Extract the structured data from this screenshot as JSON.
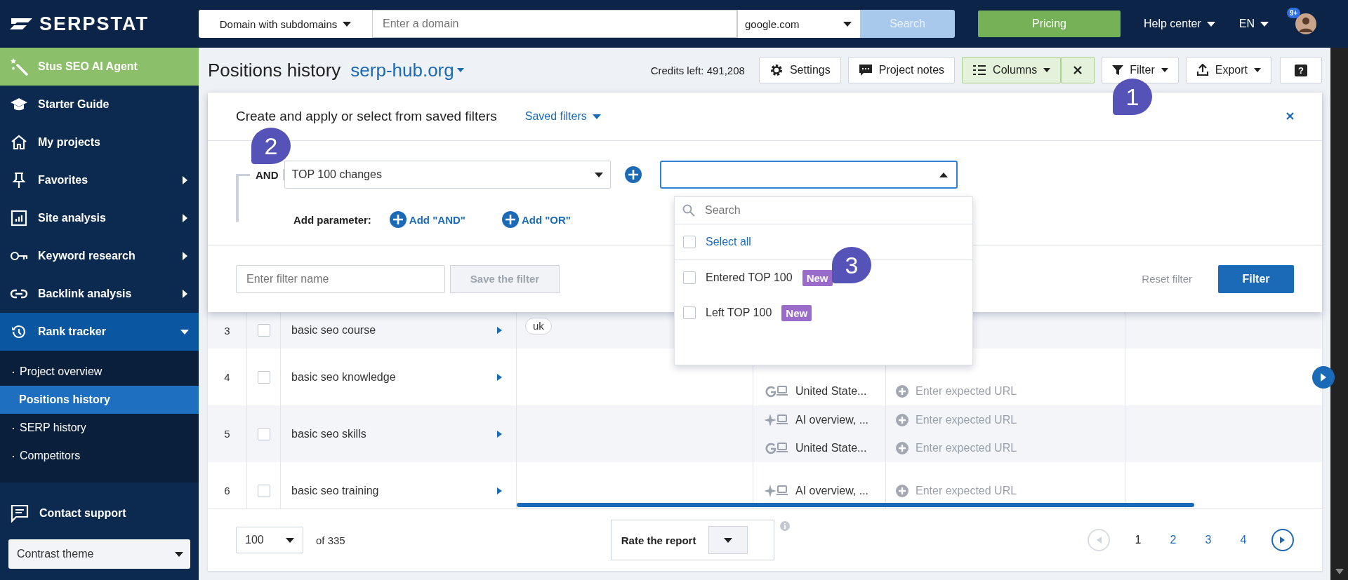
{
  "topbar": {
    "logo": "SERPSTAT",
    "search_type": "Domain with subdomains",
    "domain_placeholder": "Enter a domain",
    "engine": "google.com",
    "search_button": "Search",
    "pricing": "Pricing",
    "help": "Help center",
    "language": "EN",
    "notifications": "9+"
  },
  "sidebar": {
    "agent": "Stus SEO AI Agent",
    "items": [
      {
        "label": "Starter Guide",
        "submenu": false,
        "expanded": false
      },
      {
        "label": "My projects",
        "submenu": false,
        "expanded": false
      },
      {
        "label": "Favorites",
        "submenu": true,
        "expanded": false
      },
      {
        "label": "Site analysis",
        "submenu": true,
        "expanded": false
      },
      {
        "label": "Keyword research",
        "submenu": true,
        "expanded": false
      },
      {
        "label": "Backlink analysis",
        "submenu": true,
        "expanded": false
      },
      {
        "label": "Rank tracker",
        "submenu": true,
        "expanded": true
      }
    ],
    "subitems": [
      {
        "label": "Project overview",
        "selected": false
      },
      {
        "label": "Positions history",
        "selected": true
      },
      {
        "label": "SERP history",
        "selected": false
      },
      {
        "label": "Competitors",
        "selected": false
      }
    ],
    "support": "Contact support",
    "theme": "Contrast theme"
  },
  "header": {
    "title": "Positions history",
    "project": "serp-hub.org",
    "credits": "Credits left: 491,208",
    "settings": "Settings",
    "notes": "Project notes",
    "columns": "Columns",
    "filter": "Filter",
    "export": "Export",
    "help": "?"
  },
  "filter_panel": {
    "title": "Create and apply or select from saved filters",
    "saved": "Saved filters",
    "operator": "AND",
    "parameter": "TOP 100 changes",
    "add_label": "Add parameter:",
    "add_and": "Add \"AND\"",
    "add_or": "Add \"OR\"",
    "name_placeholder": "Enter filter name",
    "save": "Save the filter",
    "reset": "Reset filter",
    "apply": "Filter"
  },
  "dropdown": {
    "search_placeholder": "Search",
    "select_all": "Select all",
    "select_all_checked": false,
    "options": [
      {
        "label": "Entered TOP 100",
        "badge": "New",
        "checked": false
      },
      {
        "label": "Left TOP 100",
        "badge": "New",
        "checked": false
      }
    ]
  },
  "callouts": [
    "1",
    "2",
    "3"
  ],
  "table": {
    "rows": [
      {
        "number": "3",
        "keyword": "basic seo course",
        "tag": "uk",
        "checked": false,
        "engines": []
      },
      {
        "number": "4",
        "keyword": "basic seo knowledge",
        "checked": false,
        "engines": [
          {
            "kind": "none"
          },
          {
            "kind": "google",
            "label": "United State...",
            "url": "Enter expected URL"
          }
        ]
      },
      {
        "number": "5",
        "keyword": "basic seo skills",
        "checked": false,
        "engines": [
          {
            "kind": "ai",
            "label": "AI overview, ...",
            "url": "Enter expected URL"
          },
          {
            "kind": "google",
            "label": "United State...",
            "url": "Enter expected URL"
          }
        ]
      },
      {
        "number": "6",
        "keyword": "basic seo training",
        "checked": false,
        "engines": [
          {
            "kind": "ai",
            "label": "AI overview, ...",
            "url": "Enter expected URL"
          }
        ]
      }
    ]
  },
  "footer": {
    "per_page": "100",
    "total": "of 335",
    "rate": "Rate the report",
    "pages": [
      {
        "label": "1",
        "selected": true
      },
      {
        "label": "2",
        "selected": false
      },
      {
        "label": "3",
        "selected": false
      },
      {
        "label": "4",
        "selected": false
      }
    ]
  }
}
